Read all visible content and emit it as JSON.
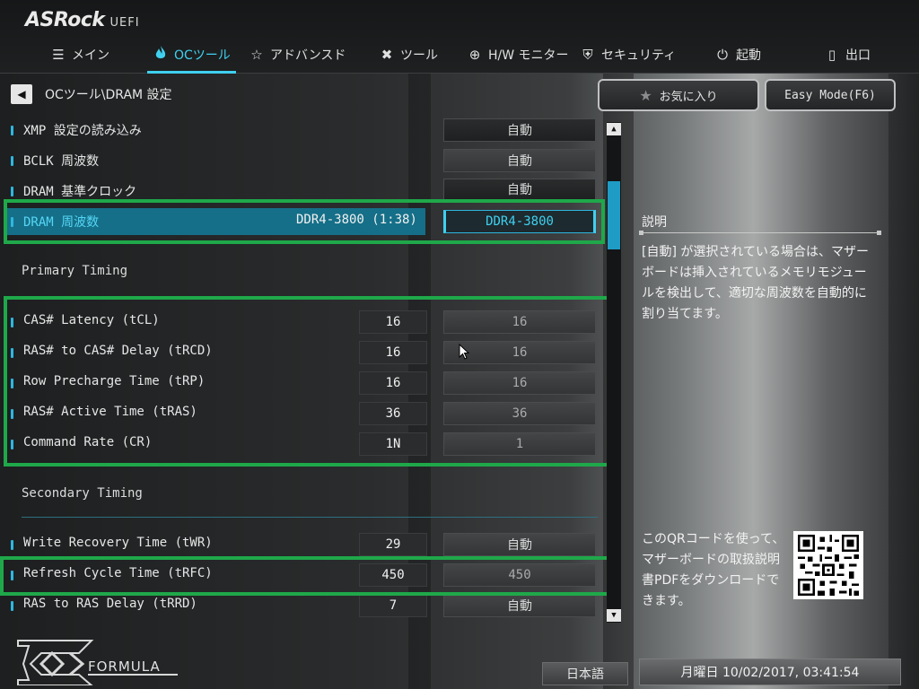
{
  "header": {
    "brand": "ASRock",
    "uefi": "UEFI"
  },
  "nav": [
    {
      "label": "メイン",
      "icon": "list-icon"
    },
    {
      "label": "OCツール",
      "icon": "flame-icon",
      "active": true
    },
    {
      "label": "アドバンスド",
      "icon": "star-icon"
    },
    {
      "label": "ツール",
      "icon": "tools-icon"
    },
    {
      "label": "H/W モニター",
      "icon": "target-icon"
    },
    {
      "label": "セキュリティ",
      "icon": "shield-icon"
    },
    {
      "label": "起動",
      "icon": "power-icon"
    },
    {
      "label": "出口",
      "icon": "exit-icon"
    }
  ],
  "breadcrumb": {
    "path": "OCツール\\DRAM 設定"
  },
  "buttons": {
    "favorites": "お気に入り",
    "easy_mode": "Easy Mode(F6)"
  },
  "rows": {
    "xmp": {
      "label": "XMP 設定の読み込み",
      "value": "自動"
    },
    "bclk": {
      "label": "BCLK 周波数",
      "value": "自動"
    },
    "dram_ref": {
      "label": "DRAM 基準クロック",
      "value": "自動"
    },
    "dram_freq": {
      "label": "DRAM 周波数",
      "current": "DDR4-3800 (1:38)",
      "value": "DDR4-3800"
    },
    "tcl": {
      "label": "CAS# Latency (tCL)",
      "current": "16",
      "value": "16"
    },
    "trcd": {
      "label": "RAS# to CAS# Delay (tRCD)",
      "current": "16",
      "value": "16"
    },
    "trp": {
      "label": "Row Precharge Time (tRP)",
      "current": "16",
      "value": "16"
    },
    "tras": {
      "label": "RAS# Active Time (tRAS)",
      "current": "36",
      "value": "36"
    },
    "cr": {
      "label": "Command Rate (CR)",
      "current": "1N",
      "value": "1"
    },
    "twr": {
      "label": "Write Recovery Time (tWR)",
      "current": "29",
      "value": "自動"
    },
    "trfc": {
      "label": "Refresh Cycle Time (tRFC)",
      "current": "450",
      "value": "450"
    },
    "trrd": {
      "label": "RAS to RAS Delay (tRRD)",
      "current": "7",
      "value": "自動"
    }
  },
  "sections": {
    "primary": "Primary Timing",
    "secondary": "Secondary Timing"
  },
  "description": {
    "title": "説明",
    "text": "[自動] が選択されている場合は、マザーボードは挿入されているメモリモジュールを検出して、適切な周波数を自動的に割り当てます。"
  },
  "qr": {
    "text": "このQRコードを使って、マザーボードの取扱説明書PDFをダウンロードできます。"
  },
  "footer": {
    "logo_text": "FORMULA",
    "language": "日本語",
    "datetime": "月曜日 10/02/2017, 03:41:54"
  },
  "colors": {
    "accent": "#3fd0f0",
    "highlight": "#156f88",
    "annotation": "#1fa84a"
  }
}
